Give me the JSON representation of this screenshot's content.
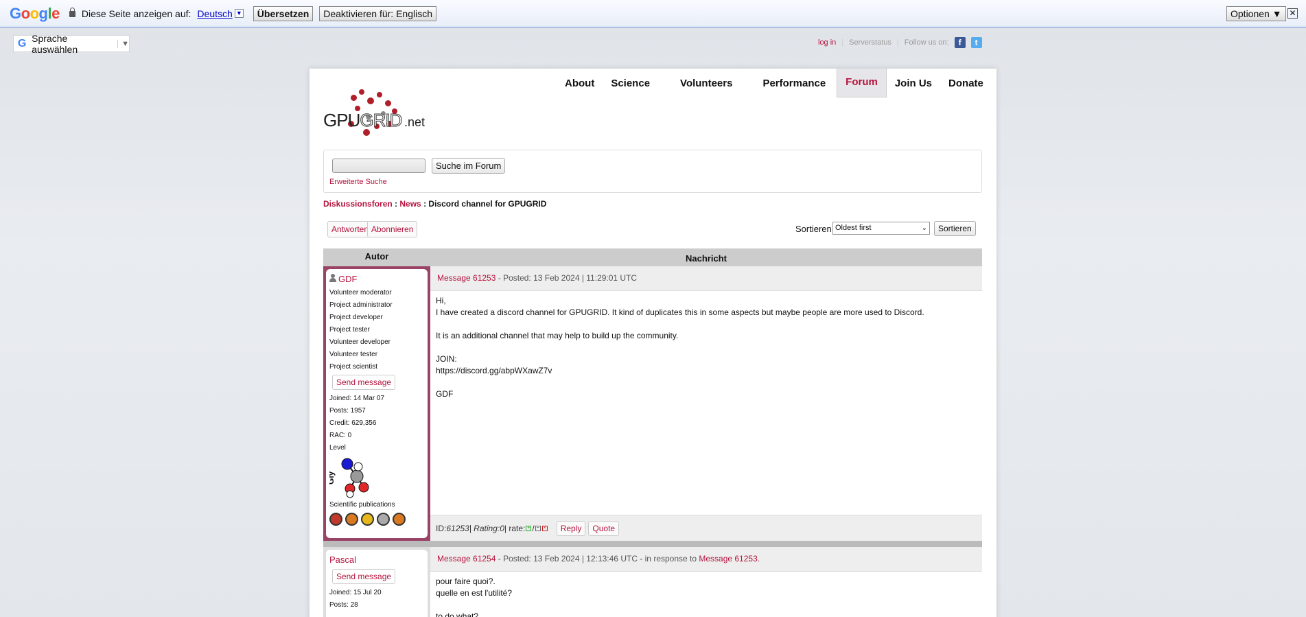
{
  "translate_bar": {
    "logo": [
      "G",
      "o",
      "o",
      "g",
      "l",
      "e"
    ],
    "prompt": "Diese Seite anzeigen auf:",
    "language": "Deutsch",
    "translate_button": "Übersetzen",
    "disable_button": "Deaktivieren für: Englisch",
    "options_button": "Optionen ▼",
    "close": "✕"
  },
  "language_selector": {
    "label": "Sprache auswählen",
    "arrow": "▼"
  },
  "top_links": {
    "login": "log in",
    "serverstatus": "Serverstatus",
    "follow": "Follow us on:"
  },
  "logo": {
    "left": "GPU",
    "mid": "GRID",
    "right": ".net"
  },
  "nav": [
    "About",
    "Science",
    "Volunteers",
    "Performance",
    "Forum",
    "Join Us",
    "Donate"
  ],
  "nav_active": "Forum",
  "search": {
    "button": "Suche im Forum",
    "advanced": "Erweiterte Suche"
  },
  "breadcrumb": {
    "root": "Diskussionsforen",
    "sep": " : ",
    "forum": "News",
    "thread": "Discord channel for GPUGRID"
  },
  "actions": {
    "reply": "Antworten",
    "subscribe": "Abonnieren",
    "sort_label": "Sortieren",
    "sort_value": "Oldest first",
    "sort_button": "Sortieren"
  },
  "table": {
    "author": "Autor",
    "message": "Nachricht"
  },
  "posts": [
    {
      "user": "GDF",
      "roles": [
        "Volunteer moderator",
        "Project administrator",
        "Project developer",
        "Project tester",
        "Volunteer developer",
        "Volunteer tester",
        "Project scientist"
      ],
      "send": "Send message",
      "joined": "Joined: 14 Mar 07",
      "posts": "Posts: 1957",
      "credit": "Credit: 629,356",
      "rac": "RAC: 0",
      "level": "Level",
      "level_code": "Gly",
      "pubs_label": "Scientific publications",
      "msg_link": "Message 61253",
      "posted": " - Posted: 13 Feb 2024 | 11:29:01 UTC",
      "body": [
        "Hi,",
        "I have created a discord channel for GPUGRID. It kind of duplicates this in some aspects but maybe people are more used to Discord.",
        "",
        "It is an additional channel that may help to build up the community.",
        "",
        "JOIN:",
        "https://discord.gg/abpWXawZ7v",
        "",
        "GDF"
      ],
      "foot": {
        "id_label": "ID: ",
        "id": "61253",
        "rating_label": " | Rating: ",
        "rating": "0",
        "rate": " | rate: ",
        "reply": "Reply",
        "quote": "Quote"
      }
    },
    {
      "user": "Pascal",
      "send": "Send message",
      "joined": "Joined: 15 Jul 20",
      "posts": "Posts: 28",
      "msg_link": "Message 61254",
      "posted": " - Posted: 13 Feb 2024 | 12:13:46 UTC - in response to ",
      "resp_link": "Message 61253",
      "resp_end": ".",
      "body": [
        "pour faire quoi?.",
        "quelle en est l'utilité?",
        "",
        "to do what?"
      ]
    }
  ],
  "colors": {
    "accent": "#b5133d",
    "user_border": "#994466"
  }
}
